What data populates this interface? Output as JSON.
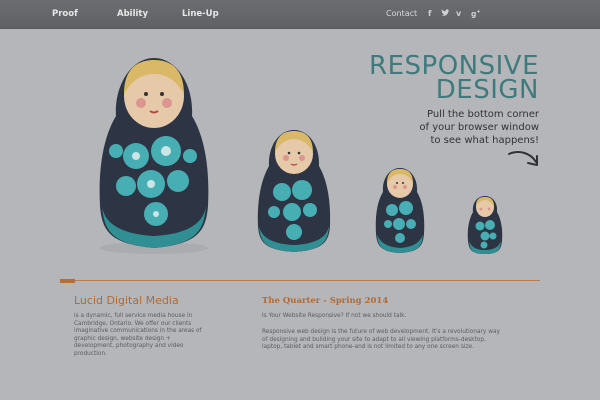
{
  "nav": {
    "items": [
      {
        "label": "Proof"
      },
      {
        "label": "Ability"
      },
      {
        "label": "Line-Up"
      }
    ],
    "contact_label": "Contact",
    "social_icons": [
      "facebook-icon",
      "twitter-icon",
      "vimeo-icon",
      "google-plus-icon"
    ]
  },
  "hero": {
    "headline_line1": "RESPONSIVE",
    "headline_line2": "DESIGN",
    "sub_line1": "Pull the bottom corner",
    "sub_line2": "of your browser window",
    "sub_line3": "to see what happens!"
  },
  "colors": {
    "background": "#b4b6b9",
    "accent_teal": "#3f7a7d",
    "accent_orange": "#b36a33",
    "doll_teal": "#2f8f93",
    "doll_dark": "#2d3443"
  },
  "company": {
    "title": "Lucid Digital Media",
    "line1": "is a dynamic, full service media house in",
    "line2": "Cambridge, Ontario. We offer our clients",
    "line3": "imaginative communications in the areas of",
    "line4": "graphic design, website design +",
    "line5": "development, photography and video",
    "line6": "production."
  },
  "article": {
    "title": "The Quarter - Spring 2014",
    "intro": "Is Your Website Responsive? If not we should talk.",
    "body1": "Responsive web design is the future of web development. It's a revolutionary way",
    "body2": "of designing and building your site to adapt to all viewing platforms-desktop,",
    "body3": "laptop, tablet and smart phone-and is not limited to any one screen size."
  }
}
